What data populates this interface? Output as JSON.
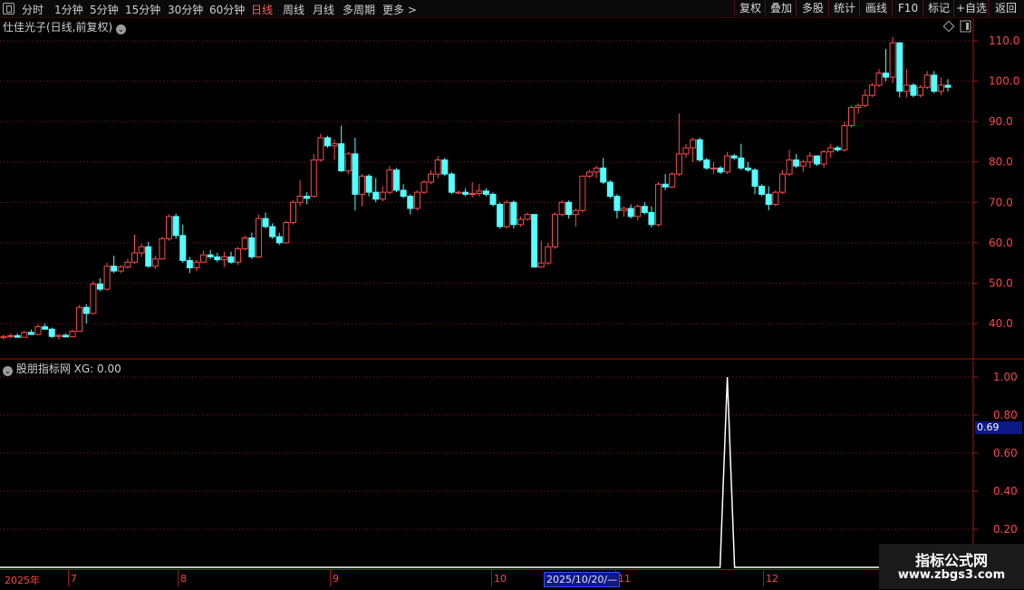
{
  "toolbar": {
    "periods": [
      "分时",
      "1分钟",
      "5分钟",
      "15分钟",
      "30分钟",
      "60分钟",
      "日线",
      "周线",
      "月线",
      "多周期",
      "更多 >"
    ],
    "active_period": "日线",
    "buttons": [
      "复权",
      "叠加",
      "多股",
      "统计",
      "画线",
      "F10",
      "标记",
      "+自选",
      "返回"
    ]
  },
  "main_panel": {
    "title": "仕佳光子(日线,前复权)",
    "y_axis_labels": [
      "110.0",
      "100.0",
      "90.0",
      "80.0",
      "70.0",
      "60.0",
      "50.0",
      "40.0"
    ]
  },
  "sub_panel": {
    "title": "股朋指标网 XG: 0.00",
    "y_axis_labels": [
      "1.00",
      "0.80",
      "0.60",
      "0.40",
      "0.20"
    ],
    "cursor_value": "0.69"
  },
  "date_axis": {
    "labels": [
      "2025年",
      "7",
      "8",
      "9",
      "10",
      "11",
      "12"
    ],
    "cursor_label": "2025/10/20/—"
  },
  "watermark": {
    "title": "指标公式网",
    "url": "www.zbgs3.com"
  },
  "colors": {
    "up": "#ff4a4a",
    "down": "#54ffff",
    "grid": "#8a1818",
    "axis": "#b01010",
    "signal": "#ffffff"
  },
  "chart_data": [
    {
      "type": "candlestick",
      "title": "仕佳光子(日线,前复权)",
      "ylim": [
        30,
        112
      ],
      "x": [
        "2025-06-23",
        "2025-06-24",
        "2025-06-25",
        "2025-06-26",
        "2025-06-27",
        "2025-06-30",
        "2025-07-01",
        "2025-07-02",
        "2025-07-03",
        "2025-07-04",
        "2025-07-07",
        "2025-07-08",
        "2025-07-09",
        "2025-07-10",
        "2025-07-11",
        "2025-07-14",
        "2025-07-15",
        "2025-07-16",
        "2025-07-17",
        "2025-07-18",
        "2025-07-21",
        "2025-07-22",
        "2025-07-23",
        "2025-07-24",
        "2025-07-25",
        "2025-07-28",
        "2025-07-29",
        "2025-07-30",
        "2025-07-31",
        "2025-08-01",
        "2025-08-04",
        "2025-08-05",
        "2025-08-06",
        "2025-08-07",
        "2025-08-08",
        "2025-08-11",
        "2025-08-12",
        "2025-08-13",
        "2025-08-14",
        "2025-08-15",
        "2025-08-18",
        "2025-08-19",
        "2025-08-20",
        "2025-08-21",
        "2025-08-22",
        "2025-08-25",
        "2025-08-26",
        "2025-08-27",
        "2025-08-28",
        "2025-08-29",
        "2025-09-01",
        "2025-09-02",
        "2025-09-03",
        "2025-09-04",
        "2025-09-05",
        "2025-09-08",
        "2025-09-09",
        "2025-09-10",
        "2025-09-11",
        "2025-09-12",
        "2025-09-15",
        "2025-09-16",
        "2025-09-17",
        "2025-09-18",
        "2025-09-19",
        "2025-09-22",
        "2025-09-23",
        "2025-09-24",
        "2025-09-25",
        "2025-09-26",
        "2025-09-29",
        "2025-09-30",
        "2025-10-09",
        "2025-10-10",
        "2025-10-13",
        "2025-10-14",
        "2025-10-15",
        "2025-10-16",
        "2025-10-17",
        "2025-10-20",
        "2025-10-21",
        "2025-10-22",
        "2025-10-23",
        "2025-10-24",
        "2025-10-27",
        "2025-10-28",
        "2025-10-29",
        "2025-10-30",
        "2025-10-31",
        "2025-11-03",
        "2025-11-04",
        "2025-11-05",
        "2025-11-06",
        "2025-11-07",
        "2025-11-10",
        "2025-11-11",
        "2025-11-12",
        "2025-11-13",
        "2025-11-14",
        "2025-11-17",
        "2025-11-18",
        "2025-11-19",
        "2025-11-20",
        "2025-11-21",
        "2025-11-24",
        "2025-11-25",
        "2025-11-26",
        "2025-11-27",
        "2025-11-28",
        "2025-12-01",
        "2025-12-02",
        "2025-12-03",
        "2025-12-04",
        "2025-12-05",
        "2025-12-08",
        "2025-12-09",
        "2025-12-10",
        "2025-12-11",
        "2025-12-12",
        "2025-12-15",
        "2025-12-16",
        "2025-12-17",
        "2025-12-18",
        "2025-12-19",
        "2025-12-22",
        "2025-12-23",
        "2025-12-24",
        "2025-12-25",
        "2025-12-26",
        "2025-12-29",
        "2025-12-30",
        "2025-12-31",
        "2026-01-05",
        "2026-01-06",
        "2026-01-07",
        "2026-01-08",
        "2026-01-09",
        "2026-01-12",
        "2026-01-13",
        "2026-01-14",
        "2026-01-15"
      ],
      "ohlc": [
        [
          36.5,
          37.2,
          36.0,
          36.8
        ],
        [
          36.8,
          37.5,
          36.3,
          37.0
        ],
        [
          37.0,
          37.6,
          36.5,
          36.6
        ],
        [
          36.6,
          38.2,
          36.5,
          37.8
        ],
        [
          37.8,
          38.5,
          37.2,
          37.3
        ],
        [
          37.3,
          39.8,
          37.1,
          39.2
        ],
        [
          39.2,
          40.0,
          38.5,
          38.6
        ],
        [
          38.6,
          39.0,
          36.4,
          36.8
        ],
        [
          36.8,
          37.4,
          36.0,
          37.1
        ],
        [
          37.1,
          37.5,
          36.5,
          36.7
        ],
        [
          36.7,
          38.5,
          36.6,
          38.1
        ],
        [
          38.1,
          44.6,
          38.0,
          44.0
        ],
        [
          44.0,
          44.8,
          40.0,
          42.5
        ],
        [
          42.5,
          50.5,
          42.3,
          49.8
        ],
        [
          49.8,
          51.2,
          48.0,
          48.5
        ],
        [
          48.5,
          55.0,
          48.2,
          54.2
        ],
        [
          54.2,
          56.8,
          52.5,
          53.0
        ],
        [
          53.0,
          54.5,
          52.5,
          54.0
        ],
        [
          54.0,
          56.0,
          53.5,
          55.2
        ],
        [
          55.2,
          62.0,
          54.8,
          57.5
        ],
        [
          57.5,
          59.8,
          56.5,
          59.0
        ],
        [
          59.0,
          60.2,
          53.8,
          54.2
        ],
        [
          54.2,
          56.8,
          53.5,
          56.0
        ],
        [
          56.0,
          61.5,
          55.8,
          61.0
        ],
        [
          61.0,
          67.0,
          60.5,
          66.5
        ],
        [
          66.5,
          67.2,
          61.0,
          61.8
        ],
        [
          61.8,
          64.5,
          55.0,
          55.6
        ],
        [
          55.6,
          56.5,
          52.5,
          53.8
        ],
        [
          53.8,
          55.8,
          53.0,
          55.2
        ],
        [
          55.2,
          58.0,
          55.0,
          57.0
        ],
        [
          57.0,
          58.2,
          56.0,
          56.5
        ],
        [
          56.5,
          57.5,
          55.2,
          55.8
        ],
        [
          55.8,
          57.8,
          54.0,
          56.5
        ],
        [
          56.5,
          57.8,
          54.8,
          55.2
        ],
        [
          55.2,
          59.0,
          54.5,
          58.5
        ],
        [
          58.5,
          61.8,
          58.0,
          61.2
        ],
        [
          61.2,
          62.5,
          56.0,
          56.5
        ],
        [
          56.5,
          67.0,
          56.2,
          66.0
        ],
        [
          66.0,
          67.5,
          63.5,
          64.0
        ],
        [
          64.0,
          64.8,
          61.0,
          61.5
        ],
        [
          61.5,
          62.5,
          59.5,
          60.0
        ],
        [
          60.0,
          65.5,
          59.8,
          65.0
        ],
        [
          65.0,
          70.5,
          64.5,
          70.0
        ],
        [
          70.0,
          75.5,
          69.0,
          71.5
        ],
        [
          71.5,
          72.5,
          69.5,
          71.0
        ],
        [
          71.5,
          82.0,
          71.2,
          80.5
        ],
        [
          80.5,
          87.0,
          80.0,
          86.0
        ],
        [
          86.0,
          86.5,
          83.5,
          84.0
        ],
        [
          84.0,
          85.5,
          80.5,
          84.5
        ],
        [
          84.5,
          89.0,
          77.5,
          77.8
        ],
        [
          77.8,
          82.5,
          77.0,
          82.0
        ],
        [
          82.0,
          86.0,
          68.0,
          72.0
        ],
        [
          72.0,
          77.0,
          69.0,
          76.5
        ],
        [
          76.5,
          77.0,
          71.5,
          72.5
        ],
        [
          72.5,
          76.0,
          70.0,
          70.8
        ],
        [
          70.8,
          74.0,
          70.2,
          72.5
        ],
        [
          72.5,
          79.0,
          72.0,
          78.0
        ],
        [
          78.0,
          78.5,
          72.5,
          73.0
        ],
        [
          73.0,
          74.5,
          71.0,
          71.5
        ],
        [
          71.5,
          72.0,
          67.0,
          68.5
        ],
        [
          68.5,
          73.0,
          68.0,
          72.5
        ],
        [
          72.5,
          75.5,
          72.0,
          75.0
        ],
        [
          75.0,
          78.0,
          74.5,
          77.0
        ],
        [
          77.0,
          81.5,
          76.0,
          80.5
        ],
        [
          80.5,
          81.0,
          76.5,
          77.0
        ],
        [
          77.0,
          77.5,
          72.0,
          72.5
        ],
        [
          72.5,
          73.0,
          72.0,
          72.5
        ],
        [
          72.5,
          73.5,
          71.5,
          72.0
        ],
        [
          72.0,
          75.0,
          71.2,
          72.2
        ],
        [
          72.2,
          74.5,
          71.5,
          72.8
        ],
        [
          72.8,
          73.5,
          71.5,
          72.0
        ],
        [
          72.0,
          72.5,
          69.0,
          69.5
        ],
        [
          69.5,
          70.0,
          63.5,
          64.0
        ],
        [
          64.0,
          70.5,
          63.5,
          70.0
        ],
        [
          70.0,
          70.5,
          63.5,
          64.5
        ],
        [
          64.5,
          66.5,
          64.0,
          65.8
        ],
        [
          65.8,
          67.5,
          65.5,
          67.0
        ],
        [
          67.0,
          58.0,
          53.8,
          54.0
        ],
        [
          54.0,
          60.5,
          53.8,
          55.0
        ],
        [
          55.0,
          60.0,
          54.5,
          59.0
        ],
        [
          59.0,
          67.5,
          58.5,
          67.0
        ],
        [
          67.0,
          70.5,
          66.5,
          70.0
        ],
        [
          70.0,
          70.5,
          66.0,
          67.0
        ],
        [
          67.0,
          68.5,
          64.0,
          68.0
        ],
        [
          68.0,
          76.0,
          67.5,
          76.5
        ],
        [
          76.5,
          78.0,
          76.0,
          77.5
        ],
        [
          77.5,
          79.0,
          76.0,
          78.5
        ],
        [
          78.5,
          81.0,
          74.5,
          75.0
        ],
        [
          75.0,
          75.5,
          71.0,
          71.5
        ],
        [
          71.5,
          72.0,
          66.0,
          68.0
        ],
        [
          68.0,
          69.0,
          66.5,
          68.5
        ],
        [
          68.5,
          69.5,
          66.0,
          66.5
        ],
        [
          66.5,
          69.5,
          65.5,
          69.0
        ],
        [
          69.0,
          70.0,
          67.0,
          67.5
        ],
        [
          67.5,
          69.0,
          63.8,
          64.5
        ],
        [
          64.5,
          75.0,
          64.0,
          74.5
        ],
        [
          74.5,
          77.0,
          73.0,
          73.8
        ],
        [
          73.8,
          77.5,
          73.5,
          77.0
        ],
        [
          77.0,
          92.0,
          76.5,
          82.0
        ],
        [
          82.0,
          84.5,
          81.0,
          83.5
        ],
        [
          83.5,
          86.0,
          80.0,
          85.5
        ],
        [
          85.5,
          86.0,
          80.0,
          80.5
        ],
        [
          80.5,
          81.0,
          78.0,
          78.5
        ],
        [
          78.5,
          80.0,
          77.0,
          78.5
        ],
        [
          78.5,
          79.0,
          77.0,
          77.5
        ],
        [
          77.5,
          82.5,
          77.0,
          81.5
        ],
        [
          81.5,
          82.0,
          80.5,
          81.0
        ],
        [
          81.0,
          84.5,
          78.0,
          78.5
        ],
        [
          78.5,
          80.0,
          77.5,
          78.0
        ],
        [
          78.0,
          78.5,
          72.0,
          74.0
        ],
        [
          74.0,
          74.5,
          71.5,
          72.0
        ],
        [
          72.0,
          74.0,
          68.0,
          69.5
        ],
        [
          69.5,
          73.0,
          69.0,
          72.5
        ],
        [
          72.5,
          78.0,
          72.0,
          77.0
        ],
        [
          77.0,
          83.0,
          76.5,
          80.5
        ],
        [
          80.5,
          82.0,
          78.5,
          79.0
        ],
        [
          79.0,
          80.5,
          77.5,
          80.0
        ],
        [
          80.0,
          82.5,
          78.5,
          81.5
        ],
        [
          81.5,
          81.5,
          79.0,
          79.5
        ],
        [
          79.5,
          83.0,
          78.5,
          82.5
        ],
        [
          82.5,
          84.5,
          81.0,
          83.5
        ],
        [
          83.5,
          84.0,
          82.5,
          83.0
        ],
        [
          83.0,
          90.0,
          82.5,
          89.0
        ],
        [
          89.0,
          94.0,
          88.5,
          93.5
        ],
        [
          93.5,
          94.5,
          92.0,
          94.0
        ],
        [
          94.0,
          98.0,
          93.5,
          96.5
        ],
        [
          96.5,
          99.5,
          96.0,
          99.0
        ],
        [
          99.0,
          103.0,
          98.5,
          102.0
        ],
        [
          102.0,
          108.0,
          100.0,
          101.0
        ],
        [
          101.0,
          111.0,
          99.5,
          109.5
        ],
        [
          109.5,
          104.5,
          96.0,
          97.5
        ],
        [
          97.5,
          103.0,
          96.0,
          99.0
        ],
        [
          99.0,
          99.5,
          96.0,
          96.5
        ],
        [
          96.5,
          99.0,
          96.0,
          98.5
        ],
        [
          98.5,
          102.5,
          98.0,
          101.5
        ],
        [
          101.5,
          102.5,
          97.0,
          97.5
        ],
        [
          97.5,
          101.0,
          96.5,
          99.0
        ],
        [
          99.0,
          100.5,
          97.5,
          98.5
        ]
      ]
    },
    {
      "type": "line",
      "title": "股朋指标网 XG: 0.00",
      "ylim": [
        0,
        1.05
      ],
      "series": [
        {
          "values": "0 for all bars except 1.0 on 2025-11-25"
        }
      ],
      "signal_date": "2025-11-25",
      "signal_value": 1.0
    }
  ]
}
